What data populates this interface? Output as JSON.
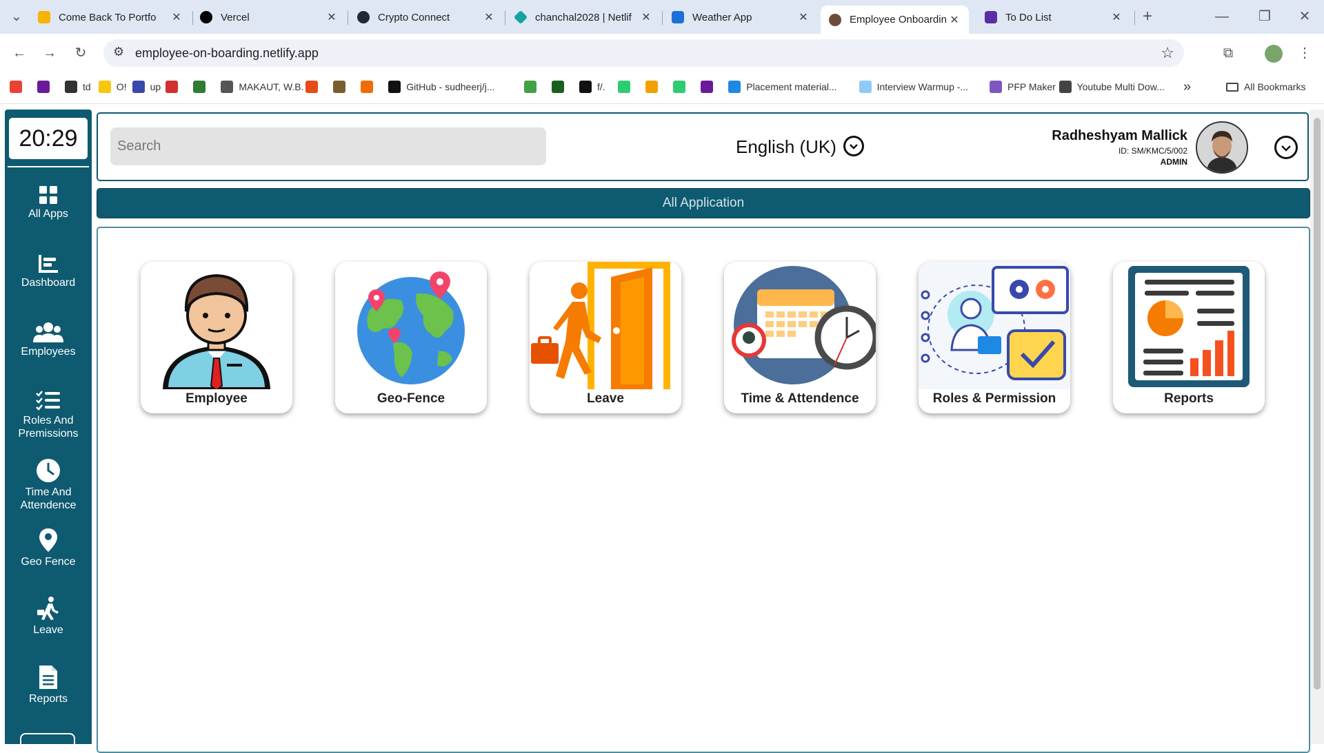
{
  "browser": {
    "tabs": [
      {
        "title": "Come Back To Portfo",
        "color": "#f4b400"
      },
      {
        "title": "Vercel",
        "color": "#000000"
      },
      {
        "title": "Crypto Connect",
        "color": "#1f2937"
      },
      {
        "title": "chanchal2028 | Netlif",
        "color": "#16a3a0"
      },
      {
        "title": "Weather App",
        "color": "#1e6fd9"
      },
      {
        "title": "Employee Onboardin",
        "color": "#6b4b3a",
        "active": true
      },
      {
        "title": "To Do List",
        "color": "#5b2ea6"
      }
    ],
    "new_tab": "+",
    "url": "employee-on-boarding.netlify.app",
    "bookmarks": [
      {
        "label": "",
        "color": "#ea4335"
      },
      {
        "label": "",
        "color": "#6a1b9a"
      },
      {
        "label": "td",
        "color": "#333333"
      },
      {
        "label": "O!",
        "color": "#f9c80e"
      },
      {
        "label": "up",
        "color": "#3949ab"
      },
      {
        "label": "",
        "color": "#d32f2f"
      },
      {
        "label": "",
        "color": "#2e7d32"
      },
      {
        "label": "MAKAUT, W.B.",
        "color": "#555555"
      },
      {
        "label": "",
        "color": "#e64a19"
      },
      {
        "label": "",
        "color": "#7b5e2e"
      },
      {
        "label": "",
        "color": "#ef6c00"
      },
      {
        "label": "GitHub - sudheerj/j...",
        "color": "#111111"
      },
      {
        "label": "",
        "color": "#43a047"
      },
      {
        "label": "",
        "color": "#1b5e20"
      },
      {
        "label": "f/.",
        "color": "#111111"
      },
      {
        "label": "",
        "color": "#2ecc71"
      },
      {
        "label": "",
        "color": "#f4a000"
      },
      {
        "label": "",
        "color": "#2ecc71"
      },
      {
        "label": "",
        "color": "#6a1b9a"
      },
      {
        "label": "Placement material...",
        "color": "#1e88e5"
      },
      {
        "label": "Interview Warmup -...",
        "color": "#90caf9"
      },
      {
        "label": "PFP Maker",
        "color": "#7e57c2"
      },
      {
        "label": "Youtube Multi Dow...",
        "color": "#444444"
      }
    ],
    "overflow": "»",
    "all_bookmarks": "All Bookmarks"
  },
  "sidebar": {
    "clock": "20:29",
    "items": [
      {
        "label": "All Apps",
        "icon": "grid-icon"
      },
      {
        "label": "Dashboard",
        "icon": "dashboard-icon"
      },
      {
        "label": "Employees",
        "icon": "people-icon"
      },
      {
        "label": "Roles And Premissions",
        "icon": "list-check-icon"
      },
      {
        "label": "Time And Attendence",
        "icon": "clock-icon"
      },
      {
        "label": "Geo Fence",
        "icon": "location-pin-icon"
      },
      {
        "label": "Leave",
        "icon": "walking-person-icon"
      },
      {
        "label": "Reports",
        "icon": "document-icon"
      }
    ]
  },
  "header": {
    "search_placeholder": "Search",
    "language": "English (UK)",
    "user_name": "Radheshyam Mallick",
    "user_id": "ID: SM/KMC/5/002",
    "user_role": "ADMIN"
  },
  "banner": "All Application",
  "apps": [
    {
      "label": "Employee"
    },
    {
      "label": "Geo-Fence"
    },
    {
      "label": "Leave"
    },
    {
      "label": "Time & Attendence"
    },
    {
      "label": "Roles & Permission"
    },
    {
      "label": "Reports"
    }
  ],
  "theme": {
    "primary": "#0e5a70",
    "accent": "#f57c00"
  }
}
